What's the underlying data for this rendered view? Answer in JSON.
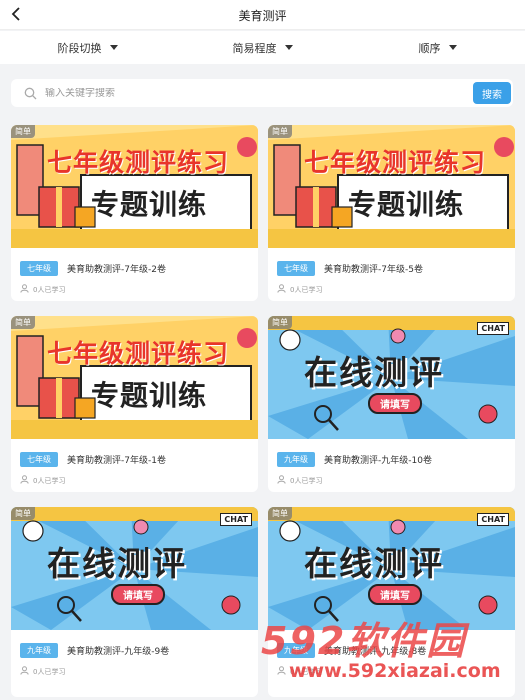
{
  "header": {
    "title": "美育测评",
    "back_icon": "chevron-left-icon"
  },
  "filters": [
    {
      "label": "阶段切换"
    },
    {
      "label": "简易程度"
    },
    {
      "label": "顺序"
    }
  ],
  "search": {
    "placeholder": "输入关键字搜索",
    "button_label": "搜索"
  },
  "banners": {
    "practice": {
      "line1": "七年级测评练习",
      "line2": "专题训练"
    },
    "online": {
      "line1": "在线测评",
      "button": "请填写",
      "chat": "CHAT"
    }
  },
  "cards": [
    {
      "difficulty": "简单",
      "grade": "七年级",
      "title": "美育助教测评-7年级-2卷",
      "learners": "0人已学习",
      "banner": "practice"
    },
    {
      "difficulty": "简单",
      "grade": "七年级",
      "title": "美育助教测评-7年级-5卷",
      "learners": "0人已学习",
      "banner": "practice"
    },
    {
      "difficulty": "简单",
      "grade": "七年级",
      "title": "美育助教测评-7年级-1卷",
      "learners": "0人已学习",
      "banner": "practice"
    },
    {
      "difficulty": "简单",
      "grade": "九年级",
      "title": "美育助教测评-九年级-10卷",
      "learners": "0人已学习",
      "banner": "online"
    },
    {
      "difficulty": "简单",
      "grade": "九年级",
      "title": "美育助教测评-九年级-9卷",
      "learners": "0人已学习",
      "banner": "online"
    },
    {
      "difficulty": "简单",
      "grade": "九年级",
      "title": "美育助教测评-九年级-8卷",
      "learners": "0人已学习",
      "banner": "online"
    }
  ],
  "watermark": {
    "brand": "592软件园",
    "url": "www.592xiazai.com"
  },
  "colors": {
    "accent": "#3aa0e8",
    "grade_badge": "#5ab4ec",
    "practice_red": "#e8352b"
  }
}
